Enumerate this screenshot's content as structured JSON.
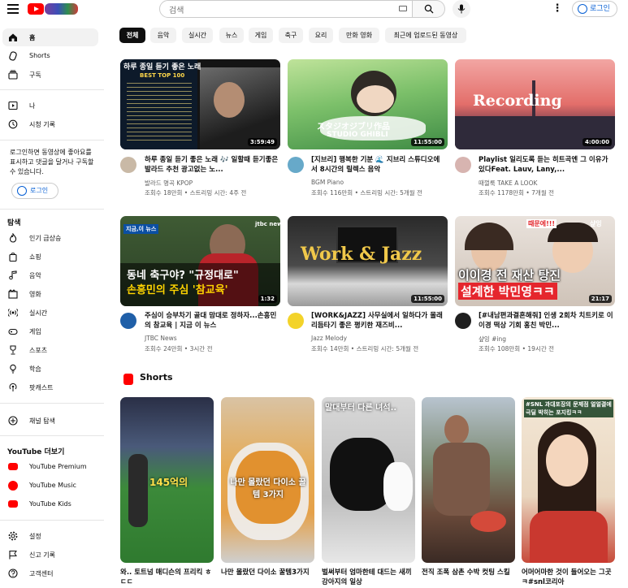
{
  "header": {
    "search_placeholder": "검색",
    "login_label": "로그인"
  },
  "sidebar": {
    "main": [
      {
        "label": "홈",
        "icon": "home-icon"
      },
      {
        "label": "Shorts",
        "icon": "shorts-icon"
      },
      {
        "label": "구독",
        "icon": "subscriptions-icon"
      }
    ],
    "you": [
      {
        "label": "나",
        "icon": "you-icon"
      },
      {
        "label": "시청 기록",
        "icon": "history-icon"
      }
    ],
    "login_note": "로그인하면 동영상에 좋아요를 표시하고 댓글을 달거나 구독할 수 있습니다.",
    "login_label": "로그인",
    "explore_title": "탐색",
    "explore": [
      {
        "label": "인기 급상승",
        "icon": "trending-icon"
      },
      {
        "label": "쇼핑",
        "icon": "shopping-icon"
      },
      {
        "label": "음악",
        "icon": "music-icon"
      },
      {
        "label": "영화",
        "icon": "movies-icon"
      },
      {
        "label": "실시간",
        "icon": "live-icon"
      },
      {
        "label": "게임",
        "icon": "gaming-icon"
      },
      {
        "label": "스포츠",
        "icon": "sports-icon"
      },
      {
        "label": "학습",
        "icon": "learning-icon"
      },
      {
        "label": "팟캐스트",
        "icon": "podcast-icon"
      }
    ],
    "browse_channels": "채널 탐색",
    "more_title": "YouTube 더보기",
    "more": [
      {
        "label": "YouTube Premium",
        "icon": "youtube-premium-icon"
      },
      {
        "label": "YouTube Music",
        "icon": "youtube-music-icon"
      },
      {
        "label": "YouTube Kids",
        "icon": "youtube-kids-icon"
      }
    ],
    "settings": [
      {
        "label": "설정",
        "icon": "settings-icon"
      },
      {
        "label": "신고 기록",
        "icon": "flag-icon"
      },
      {
        "label": "고객센터",
        "icon": "help-icon"
      }
    ]
  },
  "chips": [
    "전체",
    "음악",
    "실시간",
    "뉴스",
    "게임",
    "축구",
    "요리",
    "만화 영화",
    "최근에 업로드된 동영상"
  ],
  "videos": [
    {
      "title": "하루 종일 듣기 좋은 노래 🎶 일할때 듣기좋은 발라드 추천 광고없는 노...",
      "channel": "발라드 명곡 KPOP",
      "meta": "조회수 18만회 • 스트리밍 시간: 4주 전",
      "duration": "3:59:49",
      "thumb_line1": "하루 종일 듣기 좋은 노래",
      "thumb_line2": "BEST TOP 100"
    },
    {
      "title": "[지브리] 행복한 기분 🌊 지브리 스튜디오에서 8시간의 릴렉스 음악",
      "channel": "BGM Piano",
      "meta": "조회수 116만회 • 스트리밍 시간: 5개월 전",
      "duration": "11:55:00",
      "thumb_line1": "スタジオジブリ作品",
      "thumb_line2": "STUDIO GHIBLI"
    },
    {
      "title": "Playlist 일리도록 듣는 히트곡엔 그 이유가 있다Feat. Lauv, Lany,...",
      "channel": "때껄룩 TAKE A LOOK",
      "meta": "조회수 1178만회 • 7개월 전",
      "duration": "4:00:00",
      "thumb_line1": "Recording"
    },
    {
      "title": "주심이 승부차기 골대 맘대로 정하자...손흥민의 참교육 | 지금 이 뉴스",
      "channel": "JTBC News",
      "meta": "조회수 24만회 • 3시간 전",
      "duration": "1:32",
      "thumb_line1": "지금,이 뉴스",
      "thumb_line2": "동네 축구야? \"규정대로\"",
      "thumb_line3": "손흥민의 주심 '참교육'",
      "thumb_badge": "jtbc news"
    },
    {
      "title": "[WORK&JAZZ] 사무실에서 일하다가 몰래 리듬타기 좋은 평키한 재즈비...",
      "channel": "Jazz Melody",
      "meta": "조회수 14만회 • 스트리밍 시간: 5개월 전",
      "duration": "11:55:00",
      "thumb_line1": "Work & Jazz"
    },
    {
      "title": "[#내남편과결혼해줘] 인생 2회차 치트키로 이이경 떡상 기회 홍친 박민...",
      "channel": "샾잉 #ing",
      "meta": "조회수 108만회 • 19시간 전",
      "duration": "21:17",
      "thumb_line1": "이이경 전 재산 탕진",
      "thumb_line2": "설계한 박민영ㅋㅋ",
      "thumb_line3": "때문에!!!",
      "thumb_badge": "샾잉"
    }
  ],
  "shorts_title": "Shorts",
  "shorts": [
    {
      "title": "와.. 토트넘 매디슨의 프리킥 ㅎㄷㄷ",
      "overlay": "145억의"
    },
    {
      "title": "나만 몰랐던 다이소 꿀템3가지",
      "overlay": "나만 몰랐던 다이소 꿀템 3가지"
    },
    {
      "title": "벌써부터 엄마한테 대드는 새끼 강아지의 일상",
      "overlay": "말대부터 다른 녀석.."
    },
    {
      "title": "전직 조폭 삼촌 수박 컷팅 스킬",
      "overlay": ""
    },
    {
      "title": "어머어마한 것이 들어오는 그곳 ㅋ#snl코리아",
      "overlay": "#SNL 과대포장의 문제점 얼얼결에 극딜 박히는 포지킹ㅋㅋ"
    }
  ]
}
